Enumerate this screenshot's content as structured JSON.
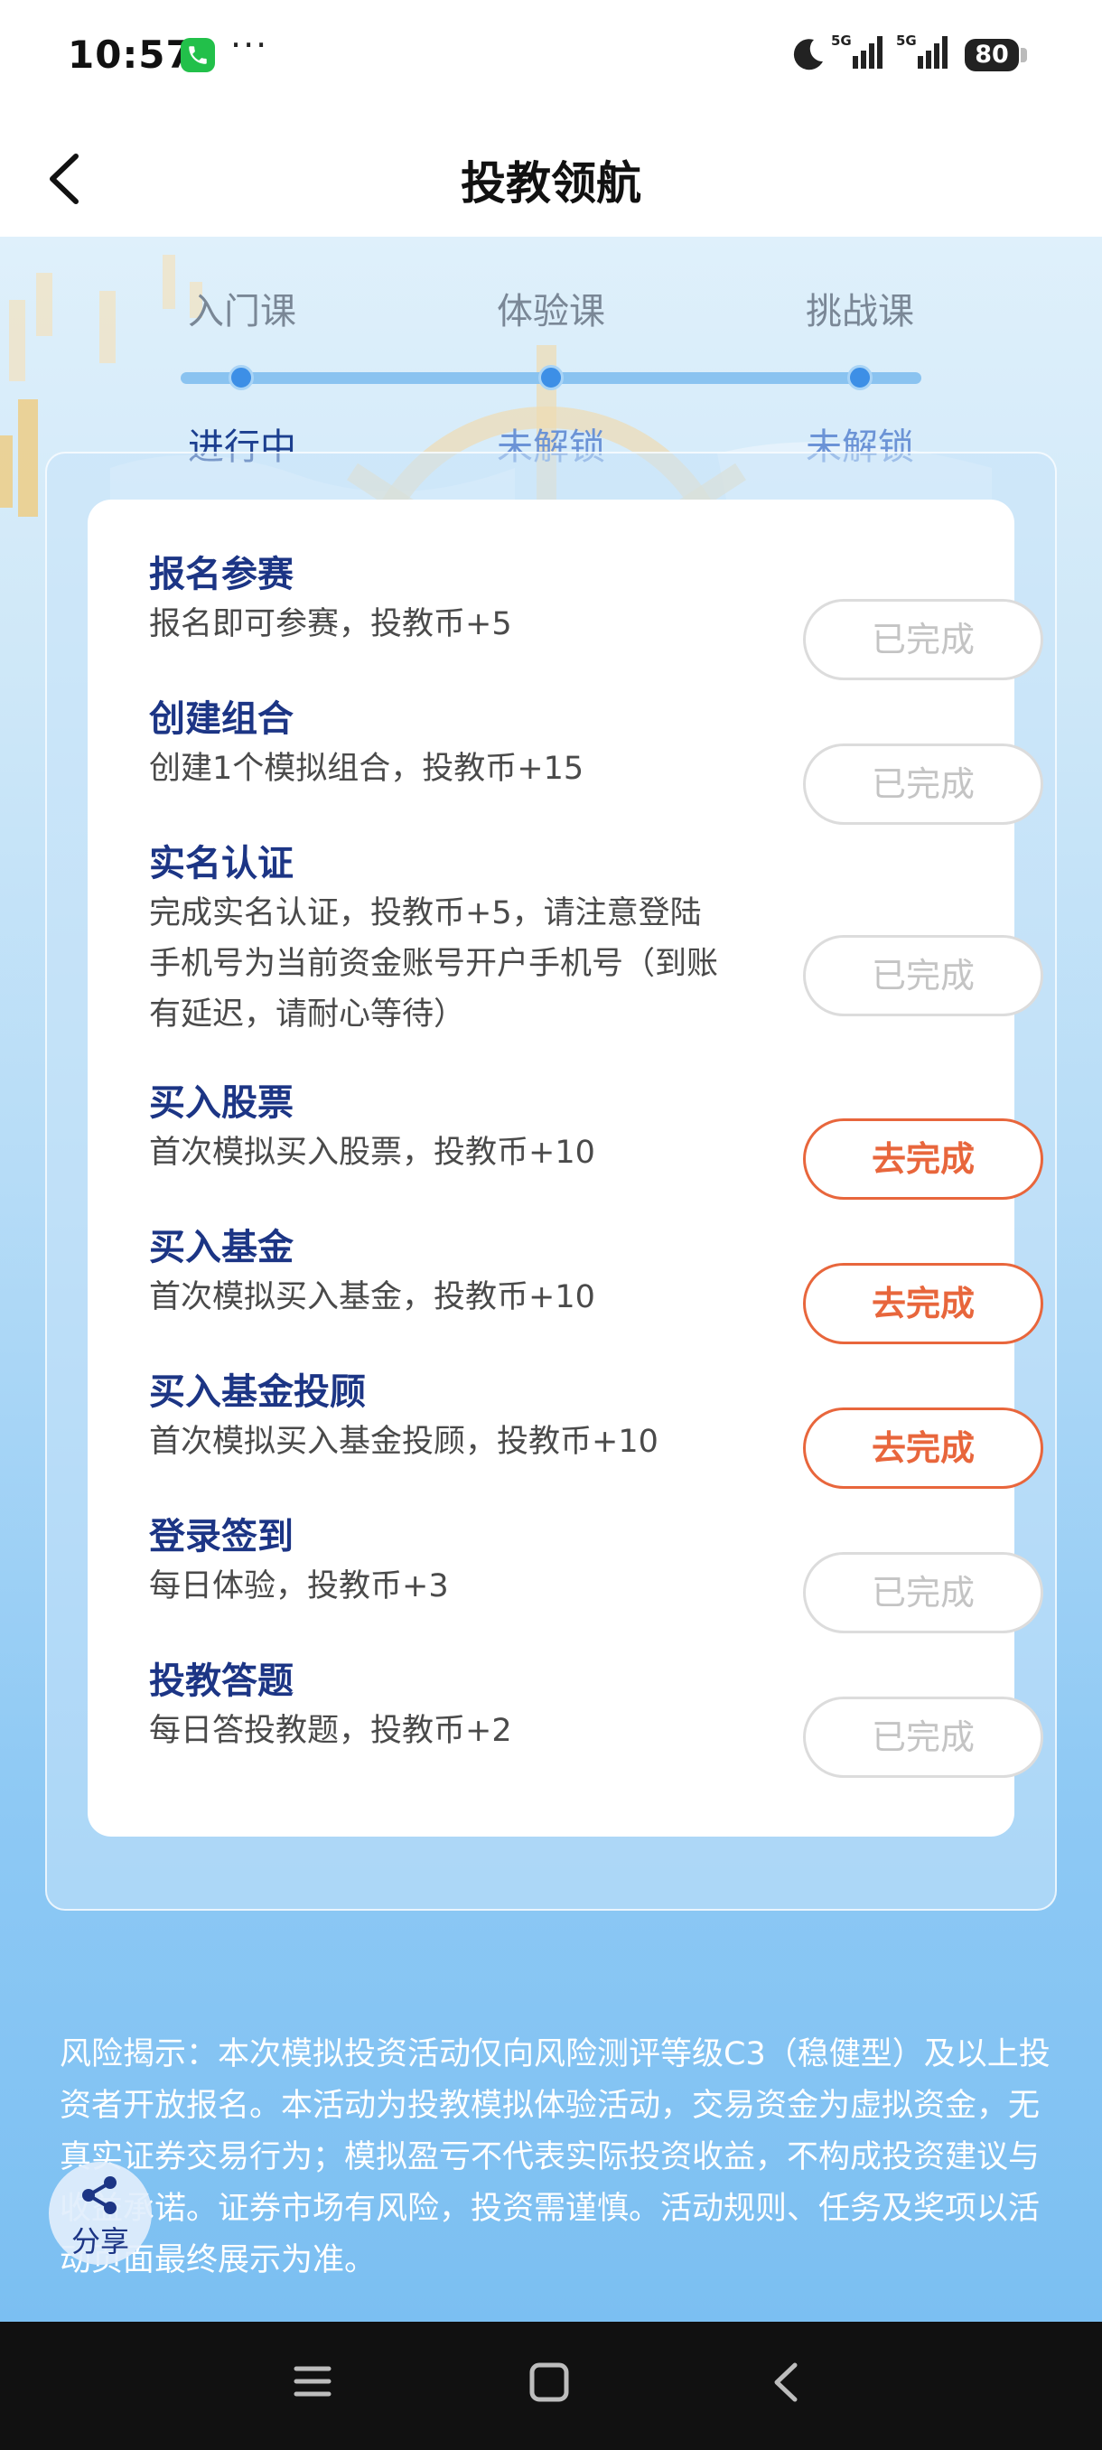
{
  "status_bar": {
    "time": "10:57",
    "more": "···",
    "battery": "80",
    "signal_labels": [
      "5G",
      "5G"
    ]
  },
  "header": {
    "title": "投教领航"
  },
  "steps": [
    {
      "name": "入门课",
      "status": "进行中"
    },
    {
      "name": "体验课",
      "status": "未解锁"
    },
    {
      "name": "挑战课",
      "status": "未解锁"
    }
  ],
  "tasks": [
    {
      "title": "报名参赛",
      "desc": "报名即可参赛，投教币+5",
      "button": "已完成"
    },
    {
      "title": "创建组合",
      "desc": "创建1个模拟组合，投教币+15",
      "button": "已完成"
    },
    {
      "title": "实名认证",
      "desc": "完成实名认证，投教币+5，请注意登陆手机号为当前资金账号开户手机号（到账有延迟，请耐心等待）",
      "button": "已完成"
    },
    {
      "title": "买入股票",
      "desc": "首次模拟买入股票，投教币+10",
      "button": "去完成"
    },
    {
      "title": "买入基金",
      "desc": "首次模拟买入基金，投教币+10",
      "button": "去完成"
    },
    {
      "title": "买入基金投顾",
      "desc": "首次模拟买入基金投顾，投教币+10",
      "button": "去完成"
    },
    {
      "title": "登录签到",
      "desc": "每日体验，投教币+3",
      "button": "已完成"
    },
    {
      "title": "投教答题",
      "desc": "每日答投教题，投教币+2",
      "button": "已完成"
    }
  ],
  "disclaimer": "风险揭示：本次模拟投资活动仅向风险测评等级C3（稳健型）及以上投资者开放报名。本活动为投教模拟体验活动，交易资金为虚拟资金，无真实证券交易行为；模拟盈亏不代表实际投资收益，不构成投资建议与收益承诺。证券市场有风险，投资需谨慎。活动规则、任务及奖项以活动页面最终展示为准。",
  "share": {
    "label": "分享"
  },
  "colors": {
    "title_blue": "#1c3585",
    "accent_orange": "#e8663c",
    "done_gray": "#c4c4c4",
    "progress_blue": "#3d8fe6"
  }
}
